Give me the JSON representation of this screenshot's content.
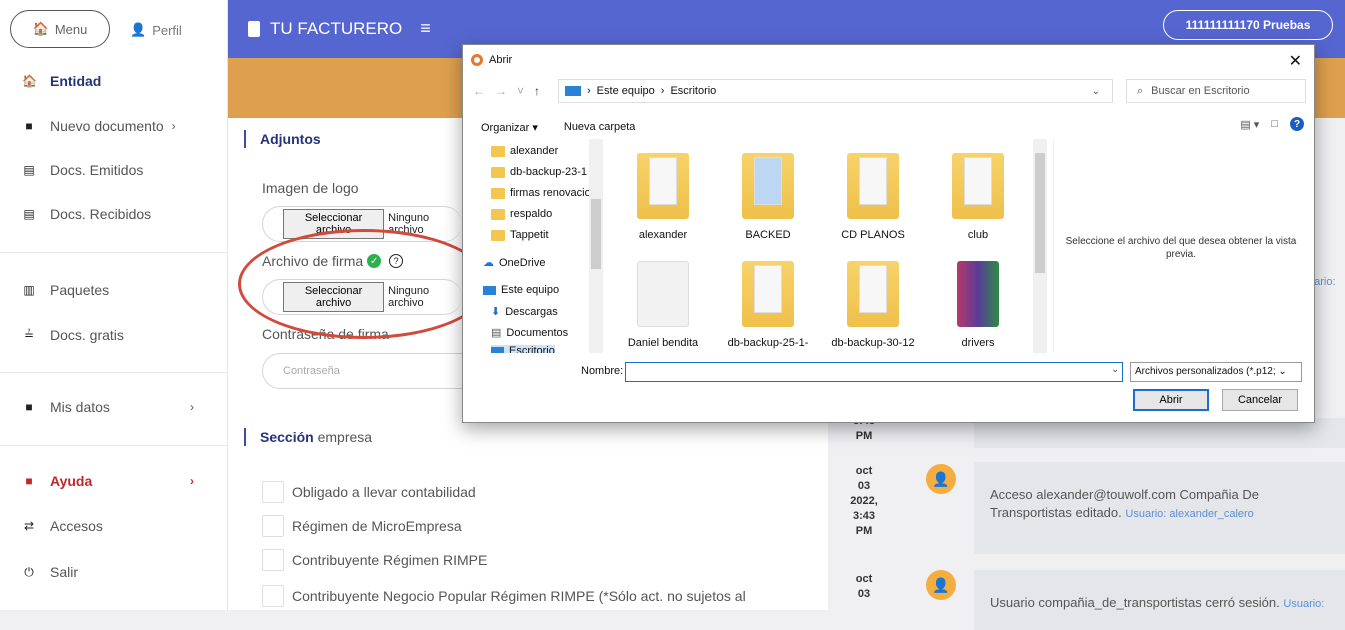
{
  "sidebar": {
    "menu_label": "Menu",
    "perfil_label": "Perfil",
    "items": [
      {
        "label": "Entidad",
        "icon": "home-icon"
      },
      {
        "label": "Nuevo documento",
        "icon": "plus-icon"
      },
      {
        "label": "Docs. Emitidos",
        "icon": "document-icon"
      },
      {
        "label": "Docs. Recibidos",
        "icon": "document-icon"
      },
      {
        "label": "Paquetes",
        "icon": "bars-icon"
      },
      {
        "label": "Docs. gratis",
        "icon": "cake-icon"
      },
      {
        "label": "Mis datos",
        "icon": "plus-icon"
      },
      {
        "label": "Ayuda",
        "icon": "plus-icon"
      },
      {
        "label": "Accesos",
        "icon": "arrows-icon"
      },
      {
        "label": "Salir",
        "icon": "power-icon"
      }
    ]
  },
  "header": {
    "brand": "TU FACTURERO",
    "user": "111111111170 Pruebas"
  },
  "form": {
    "adjuntos_title": "Adjuntos",
    "logo_label": "Imagen de logo",
    "file_button": "Seleccionar archivo",
    "file_none": "Ninguno archivo",
    "firma_label": "Archivo de firma",
    "password_label": "Contraseña de firma",
    "password_placeholder": "Contraseña",
    "empresa_title_bold": "Sección",
    "empresa_title_rest": " empresa",
    "checks": [
      "Obligado a llevar contabilidad",
      "Régimen de MicroEmpresa",
      "Contribuyente Régimen RIMPE",
      "Contribuyente Negocio Popular Régimen RIMPE (*Sólo act. no sujetos al"
    ]
  },
  "timeline": [
    {
      "date": "3:43\nPM",
      "text": "",
      "user": ""
    },
    {
      "date": "oct\n03\n2022,\n3:43\nPM",
      "text": "Acceso alexander@touwolf.com Compañia De Transportistas editado.",
      "user": "Usuario: alexander_calero"
    },
    {
      "date": "oct\n03",
      "text": "Usuario compañia_de_transportistas cerró sesión.",
      "user": "Usuario:"
    }
  ],
  "timeline_partial_user": "uario:",
  "dialog": {
    "title": "Abrir",
    "path": [
      "Este equipo",
      "Escritorio"
    ],
    "search_placeholder": "Buscar en Escritorio",
    "organize": "Organizar",
    "new_folder": "Nueva carpeta",
    "tree": [
      {
        "label": "alexander",
        "type": "folder"
      },
      {
        "label": "db-backup-23-1",
        "type": "folder"
      },
      {
        "label": "firmas renovacio",
        "type": "folder"
      },
      {
        "label": "respaldo",
        "type": "folder"
      },
      {
        "label": "Tappetit",
        "type": "folder"
      },
      {
        "label": "OneDrive",
        "type": "cloud"
      },
      {
        "label": "Este equipo",
        "type": "pc"
      },
      {
        "label": "Descargas",
        "type": "download"
      },
      {
        "label": "Documentos",
        "type": "doc"
      },
      {
        "label": "Escritorio",
        "type": "desk"
      }
    ],
    "files": [
      {
        "label": "alexander",
        "kind": "folder"
      },
      {
        "label": "BACKED",
        "kind": "folder"
      },
      {
        "label": "CD PLANOS",
        "kind": "folder"
      },
      {
        "label": "club",
        "kind": "folder"
      },
      {
        "label": "Daniel bendita",
        "kind": "white"
      },
      {
        "label": "db-backup-25-1-",
        "kind": "folder"
      },
      {
        "label": "db-backup-30-12",
        "kind": "folder"
      },
      {
        "label": "drivers",
        "kind": "rar"
      }
    ],
    "preview_text": "Seleccione el archivo del que desea obtener la vista previa.",
    "name_label": "Nombre:",
    "name_value": "",
    "filter": "Archivos personalizados (*.p12;",
    "open_button": "Abrir",
    "cancel_button": "Cancelar"
  }
}
